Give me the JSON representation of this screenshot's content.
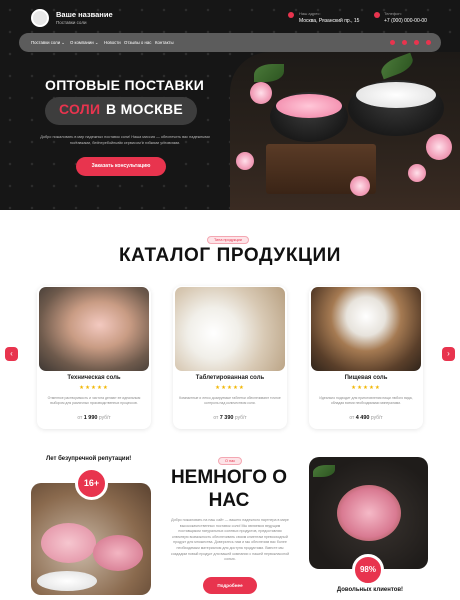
{
  "brand": {
    "name": "Ваше название",
    "subtitle": "Поставки соли"
  },
  "contacts": {
    "address_label": "Наш адрес:",
    "address": "Москва, Рязанский пр., 15",
    "phone_label": "Телефон:",
    "phone": "+7 (000) 000-00-00"
  },
  "nav": {
    "items": [
      "Поставки соли",
      "О компании",
      "Новости",
      "Отзывы о нас",
      "Контакты"
    ]
  },
  "hero": {
    "title_line1": "ОПТОВЫЕ ПОСТАВКИ",
    "title_accent": "СОЛИ",
    "title_line2": "В МОСКВЕ",
    "description": "Добро пожаловать в мир надежных поставок соли! Наша миссия — обеспечить вас надежными поставками, бесперебойными сервисом и гибкими условиями.",
    "cta": "Заказать консультацию"
  },
  "catalog": {
    "badge": "Типа продукции",
    "title": "КАТАЛОГ ПРОДУКЦИИ",
    "products": [
      {
        "name": "Техническая соль",
        "rating": 5,
        "stars": "★★★★★",
        "description": "Отменное растворимость и чистота делают ее идеальным выбором для различных производственных процессов.",
        "price_prefix": "от",
        "price": "1 990",
        "unit": "руб/т"
      },
      {
        "name": "Таблетированная соль",
        "rating": 5,
        "stars": "★★★★★",
        "description": "Компактные и легко дозируемые таблетки обеспечивают точное контроль над количеством соли.",
        "price_prefix": "от",
        "price": "7 390",
        "unit": "руб/т"
      },
      {
        "name": "Пищевая соль",
        "rating": 5,
        "stars": "★★★★★",
        "description": "Идеально подходит для приготовления пищи любого вида, обладая всеми необходимыми минералами.",
        "price_prefix": "от",
        "price": "4 490",
        "unit": "руб/т"
      }
    ],
    "prev_icon": "‹",
    "next_icon": "›"
  },
  "about": {
    "reputation_title": "Лет безупречной репутации!",
    "years_badge": "16+",
    "badge": "О нас",
    "title": "НЕМНОГО О НАС",
    "description": "Добро пожаловать на наш сайт — вашего надежного партнера в мире высококачественных поставок соли! Мы являемся ведущим поставщиком натуральных солевых продуктов, предоставляя ключевую возможность обеспечивать своим клиентам превосходный продукт для множества. Доверьтесь нам и мы обеспечим вас более необходимым материалом для доступа продуктами. Вместе мы создадим новый продукт для вашей компании с нашей первоклассной солью.",
    "button": "Подробнее",
    "clients_badge": "98%",
    "clients_title": "Довольных клиентов!"
  },
  "colors": {
    "accent": "#e8344e",
    "dark": "#161616",
    "nav": "#5c5c5c"
  }
}
